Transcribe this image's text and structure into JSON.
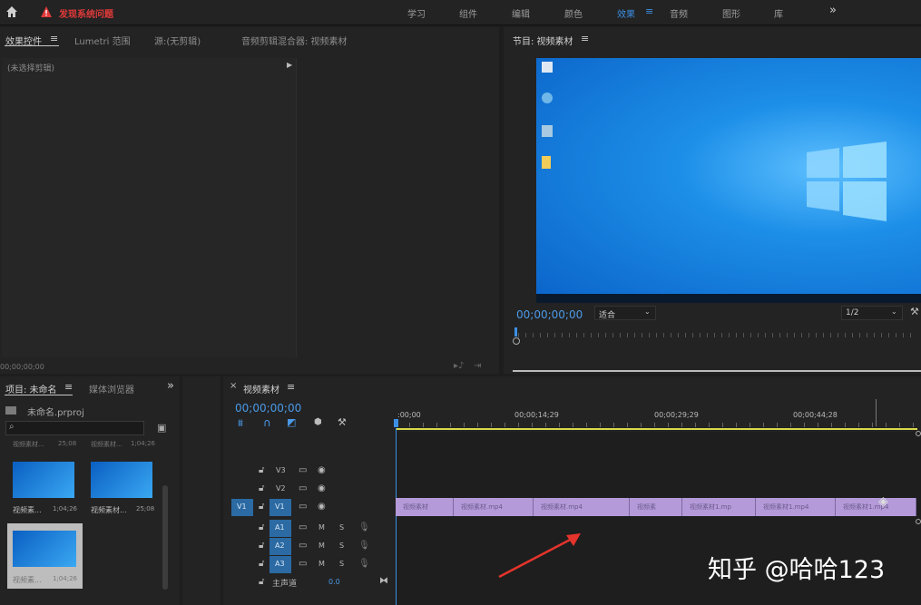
{
  "topbar": {
    "home_icon": "home-icon",
    "warning_icon": "warning-icon",
    "alert_text": "发现系统问题",
    "workspaces": [
      "学习",
      "组件",
      "编辑",
      "颜色",
      "效果",
      "音频",
      "图形",
      "库"
    ],
    "active_workspace": "效果",
    "more": "»"
  },
  "effect_controls": {
    "tabs": [
      "效果控件",
      "Lumetri 范围",
      "源:(无剪辑)",
      "音频剪辑混合器: 视频素材"
    ],
    "no_clip": "(未选择剪辑)",
    "timecode": "00;00;00;00"
  },
  "program": {
    "title": "节目: 视频素材",
    "timecode": "00;00;00;00",
    "fit": "适合",
    "resolution": "1/2"
  },
  "project": {
    "tabs": [
      "项目: 未命名",
      "媒体浏览器"
    ],
    "file": "未命名.prproj",
    "more": "»",
    "items": [
      {
        "name": "视频素...",
        "dur": "1;04;26"
      },
      {
        "name": "视频素材...",
        "dur": "25;08"
      },
      {
        "name": "视频素...",
        "dur": "1;04;26"
      }
    ],
    "top_row": [
      "视频素材...",
      "25;08",
      "视频素材...",
      "1;04;26"
    ]
  },
  "timeline": {
    "title": "视频素材",
    "close": "×",
    "timecode": "00;00;00;00",
    "ruler": [
      ":00;00",
      "00;00;14;29",
      "00;00;29;29",
      "00;00;44;28"
    ],
    "tracks": [
      "V3",
      "V2",
      "V1",
      "A1",
      "A2",
      "A3"
    ],
    "v1_source": "V1",
    "mix_label": "主声道",
    "mix_value": "0.0",
    "m": "M",
    "s": "S",
    "clips": [
      "视频素材",
      "视频素材.mp4",
      "视频素材.mp4",
      "视频素",
      "视频素材1.mp",
      "视频素材1.mp4",
      "视频素材1.mp4"
    ]
  },
  "watermark": "知乎 @哈哈123",
  "colors": {
    "accent": "#3b8fe4",
    "clip": "#b49ad9",
    "alert": "#e23a3a",
    "desktop": "#1f8fe6"
  }
}
